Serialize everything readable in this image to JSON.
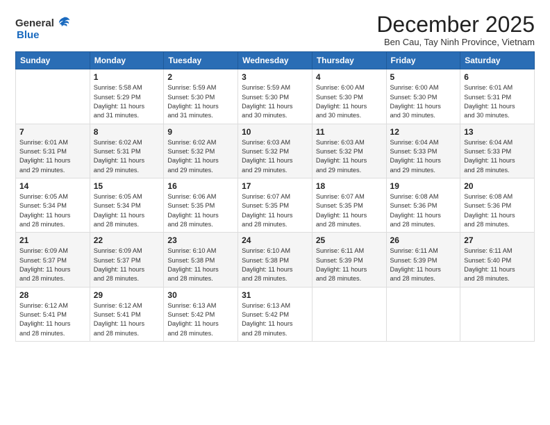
{
  "header": {
    "logo_general": "General",
    "logo_blue": "Blue",
    "month_title": "December 2025",
    "subtitle": "Ben Cau, Tay Ninh Province, Vietnam"
  },
  "days_of_week": [
    "Sunday",
    "Monday",
    "Tuesday",
    "Wednesday",
    "Thursday",
    "Friday",
    "Saturday"
  ],
  "weeks": [
    [
      {
        "day": "",
        "info": ""
      },
      {
        "day": "1",
        "info": "Sunrise: 5:58 AM\nSunset: 5:29 PM\nDaylight: 11 hours\nand 31 minutes."
      },
      {
        "day": "2",
        "info": "Sunrise: 5:59 AM\nSunset: 5:30 PM\nDaylight: 11 hours\nand 31 minutes."
      },
      {
        "day": "3",
        "info": "Sunrise: 5:59 AM\nSunset: 5:30 PM\nDaylight: 11 hours\nand 30 minutes."
      },
      {
        "day": "4",
        "info": "Sunrise: 6:00 AM\nSunset: 5:30 PM\nDaylight: 11 hours\nand 30 minutes."
      },
      {
        "day": "5",
        "info": "Sunrise: 6:00 AM\nSunset: 5:30 PM\nDaylight: 11 hours\nand 30 minutes."
      },
      {
        "day": "6",
        "info": "Sunrise: 6:01 AM\nSunset: 5:31 PM\nDaylight: 11 hours\nand 30 minutes."
      }
    ],
    [
      {
        "day": "7",
        "info": "Sunrise: 6:01 AM\nSunset: 5:31 PM\nDaylight: 11 hours\nand 29 minutes."
      },
      {
        "day": "8",
        "info": "Sunrise: 6:02 AM\nSunset: 5:31 PM\nDaylight: 11 hours\nand 29 minutes."
      },
      {
        "day": "9",
        "info": "Sunrise: 6:02 AM\nSunset: 5:32 PM\nDaylight: 11 hours\nand 29 minutes."
      },
      {
        "day": "10",
        "info": "Sunrise: 6:03 AM\nSunset: 5:32 PM\nDaylight: 11 hours\nand 29 minutes."
      },
      {
        "day": "11",
        "info": "Sunrise: 6:03 AM\nSunset: 5:32 PM\nDaylight: 11 hours\nand 29 minutes."
      },
      {
        "day": "12",
        "info": "Sunrise: 6:04 AM\nSunset: 5:33 PM\nDaylight: 11 hours\nand 29 minutes."
      },
      {
        "day": "13",
        "info": "Sunrise: 6:04 AM\nSunset: 5:33 PM\nDaylight: 11 hours\nand 28 minutes."
      }
    ],
    [
      {
        "day": "14",
        "info": "Sunrise: 6:05 AM\nSunset: 5:34 PM\nDaylight: 11 hours\nand 28 minutes."
      },
      {
        "day": "15",
        "info": "Sunrise: 6:05 AM\nSunset: 5:34 PM\nDaylight: 11 hours\nand 28 minutes."
      },
      {
        "day": "16",
        "info": "Sunrise: 6:06 AM\nSunset: 5:35 PM\nDaylight: 11 hours\nand 28 minutes."
      },
      {
        "day": "17",
        "info": "Sunrise: 6:07 AM\nSunset: 5:35 PM\nDaylight: 11 hours\nand 28 minutes."
      },
      {
        "day": "18",
        "info": "Sunrise: 6:07 AM\nSunset: 5:35 PM\nDaylight: 11 hours\nand 28 minutes."
      },
      {
        "day": "19",
        "info": "Sunrise: 6:08 AM\nSunset: 5:36 PM\nDaylight: 11 hours\nand 28 minutes."
      },
      {
        "day": "20",
        "info": "Sunrise: 6:08 AM\nSunset: 5:36 PM\nDaylight: 11 hours\nand 28 minutes."
      }
    ],
    [
      {
        "day": "21",
        "info": "Sunrise: 6:09 AM\nSunset: 5:37 PM\nDaylight: 11 hours\nand 28 minutes."
      },
      {
        "day": "22",
        "info": "Sunrise: 6:09 AM\nSunset: 5:37 PM\nDaylight: 11 hours\nand 28 minutes."
      },
      {
        "day": "23",
        "info": "Sunrise: 6:10 AM\nSunset: 5:38 PM\nDaylight: 11 hours\nand 28 minutes."
      },
      {
        "day": "24",
        "info": "Sunrise: 6:10 AM\nSunset: 5:38 PM\nDaylight: 11 hours\nand 28 minutes."
      },
      {
        "day": "25",
        "info": "Sunrise: 6:11 AM\nSunset: 5:39 PM\nDaylight: 11 hours\nand 28 minutes."
      },
      {
        "day": "26",
        "info": "Sunrise: 6:11 AM\nSunset: 5:39 PM\nDaylight: 11 hours\nand 28 minutes."
      },
      {
        "day": "27",
        "info": "Sunrise: 6:11 AM\nSunset: 5:40 PM\nDaylight: 11 hours\nand 28 minutes."
      }
    ],
    [
      {
        "day": "28",
        "info": "Sunrise: 6:12 AM\nSunset: 5:41 PM\nDaylight: 11 hours\nand 28 minutes."
      },
      {
        "day": "29",
        "info": "Sunrise: 6:12 AM\nSunset: 5:41 PM\nDaylight: 11 hours\nand 28 minutes."
      },
      {
        "day": "30",
        "info": "Sunrise: 6:13 AM\nSunset: 5:42 PM\nDaylight: 11 hours\nand 28 minutes."
      },
      {
        "day": "31",
        "info": "Sunrise: 6:13 AM\nSunset: 5:42 PM\nDaylight: 11 hours\nand 28 minutes."
      },
      {
        "day": "",
        "info": ""
      },
      {
        "day": "",
        "info": ""
      },
      {
        "day": "",
        "info": ""
      }
    ]
  ]
}
